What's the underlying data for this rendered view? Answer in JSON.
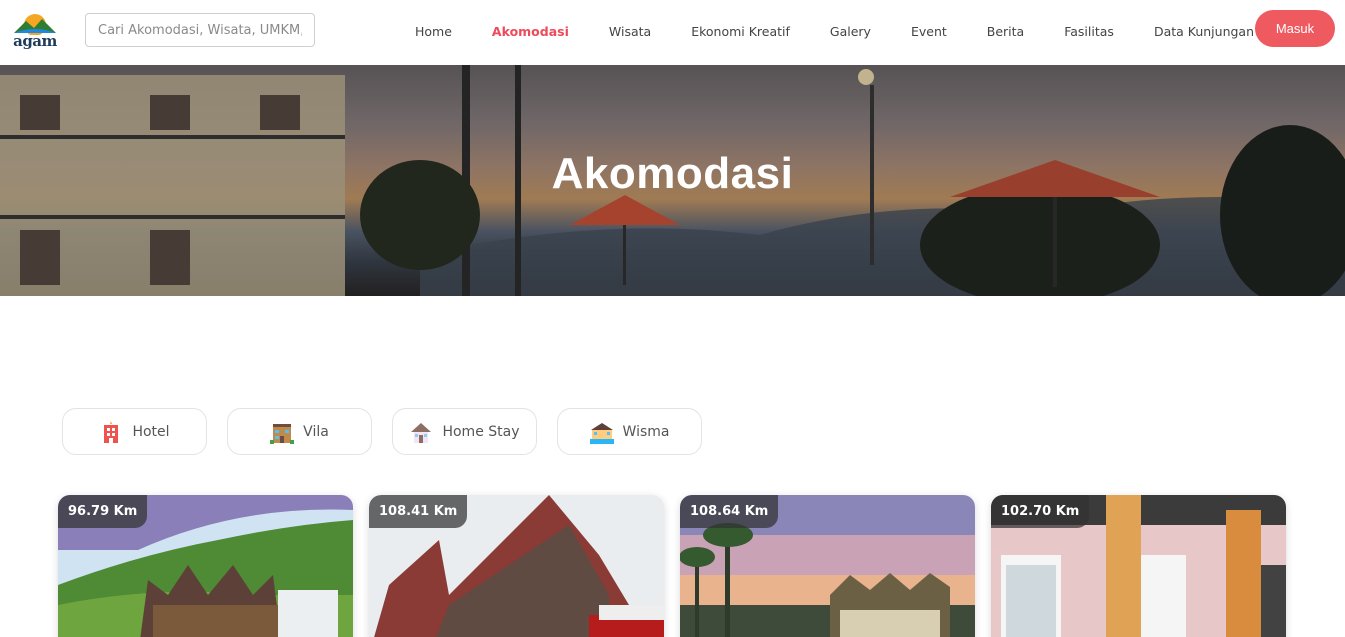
{
  "navbar": {
    "logo_text": "agam",
    "search": {
      "placeholder": "Cari Akomodasi, Wisata, UMKM, ..",
      "value": ""
    },
    "links": [
      {
        "label": "Home",
        "active": false
      },
      {
        "label": "Akomodasi",
        "active": true
      },
      {
        "label": "Wisata",
        "active": false
      },
      {
        "label": "Ekonomi Kreatif",
        "active": false
      },
      {
        "label": "Galery",
        "active": false
      },
      {
        "label": "Event",
        "active": false
      },
      {
        "label": "Berita",
        "active": false
      },
      {
        "label": "Fasilitas",
        "active": false
      },
      {
        "label": "Data Kunjungan",
        "active": false
      }
    ],
    "login_label": "Masuk",
    "accent_color": "#ef5a60"
  },
  "hero": {
    "title": "Akomodasi"
  },
  "categories": [
    {
      "label": "Hotel",
      "icon": "hotel-icon"
    },
    {
      "label": "Vila",
      "icon": "villa-icon"
    },
    {
      "label": "Home Stay",
      "icon": "house-icon"
    },
    {
      "label": "Wisma",
      "icon": "guesthouse-icon"
    }
  ],
  "cards": [
    {
      "distance": "96.79 Km"
    },
    {
      "distance": "108.41 Km"
    },
    {
      "distance": "108.64 Km"
    },
    {
      "distance": "102.70 Km"
    }
  ]
}
